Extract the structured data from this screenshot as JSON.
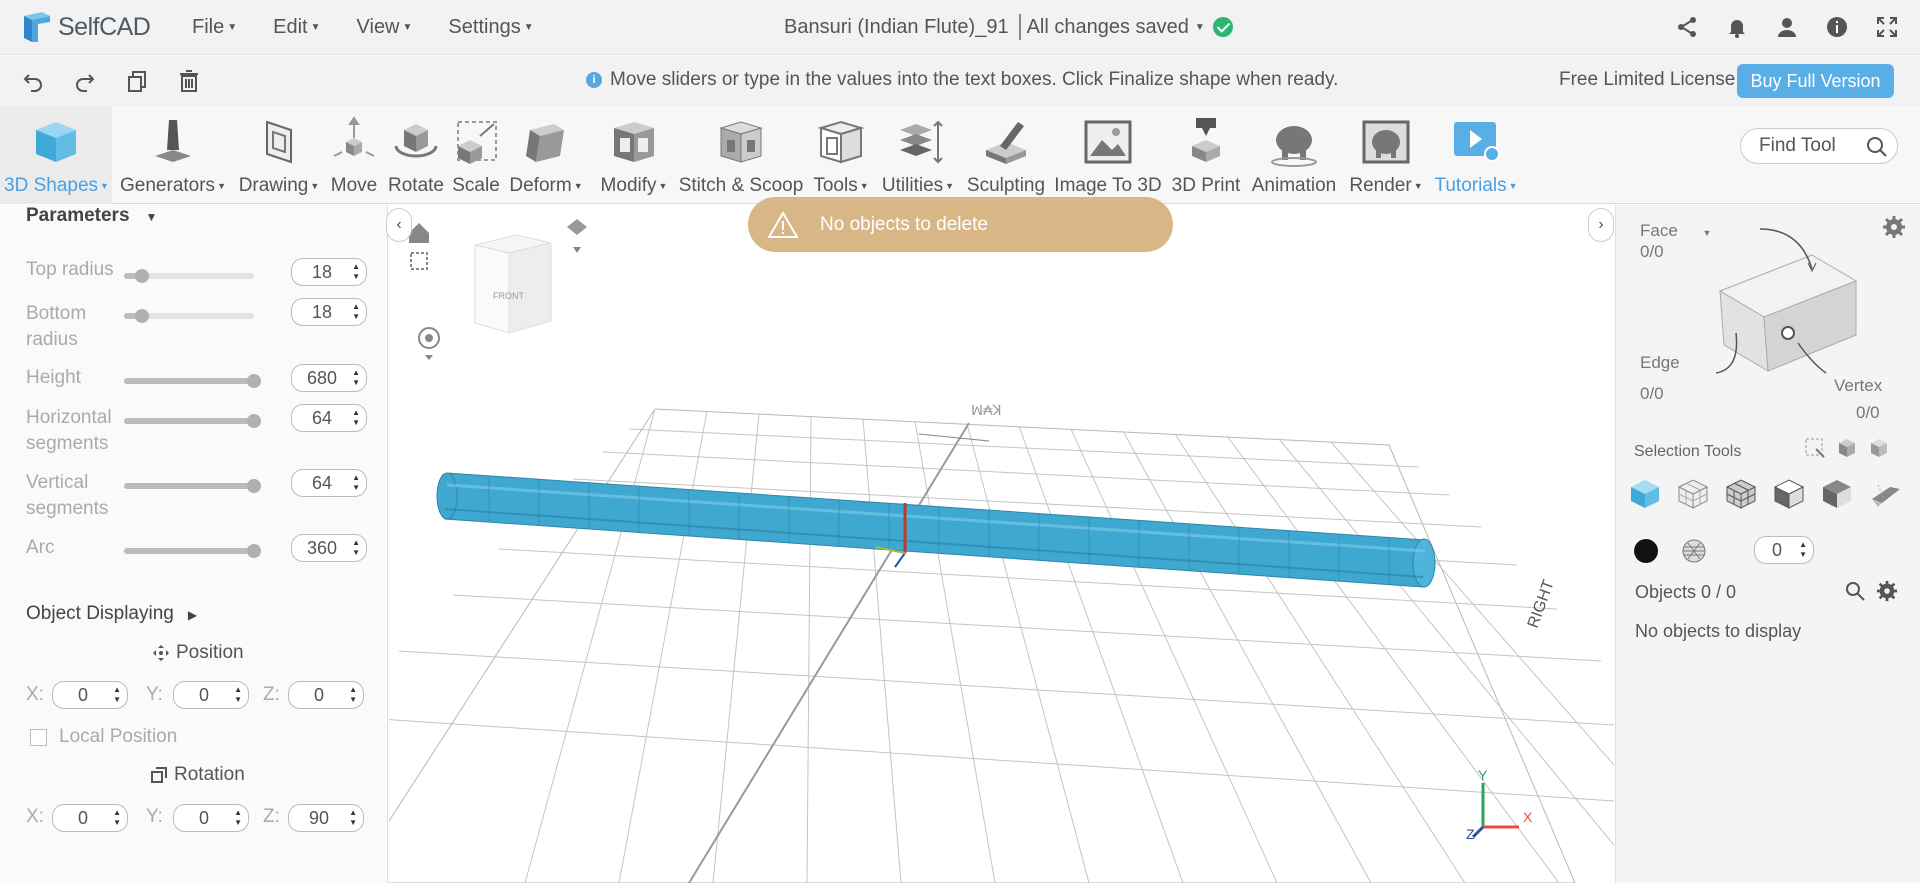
{
  "app": {
    "logo_text": "SelfCAD",
    "menus": [
      {
        "label": "File"
      },
      {
        "label": "Edit"
      },
      {
        "label": "View"
      },
      {
        "label": "Settings"
      }
    ],
    "document_title": "Bansuri (Indian Flute)_91",
    "save_status": "All changes saved"
  },
  "hintbar": {
    "hint": "Move sliders or type in the values into the text boxes. Click Finalize shape when ready.",
    "license": "Free Limited License",
    "buy_label": "Buy Full Version"
  },
  "toolbar": {
    "tools": [
      {
        "label": "3D Shapes",
        "icon": "cube-icon"
      },
      {
        "label": "Generators",
        "icon": "generator-icon"
      },
      {
        "label": "Drawing",
        "icon": "drawing-icon"
      },
      {
        "label": "Move",
        "icon": "move-icon"
      },
      {
        "label": "Rotate",
        "icon": "rotate-icon"
      },
      {
        "label": "Scale",
        "icon": "scale-icon"
      },
      {
        "label": "Deform",
        "icon": "deform-icon"
      },
      {
        "label": "Modify",
        "icon": "modify-icon"
      },
      {
        "label": "Stitch & Scoop",
        "icon": "stitch-scoop-icon"
      },
      {
        "label": "Tools",
        "icon": "tools-icon"
      },
      {
        "label": "Utilities",
        "icon": "utilities-icon"
      },
      {
        "label": "Sculpting",
        "icon": "sculpting-icon"
      },
      {
        "label": "Image To 3D",
        "icon": "image-to-3d-icon"
      },
      {
        "label": "3D Print",
        "icon": "3d-print-icon"
      },
      {
        "label": "Animation",
        "icon": "animation-icon"
      },
      {
        "label": "Render",
        "icon": "render-icon"
      },
      {
        "label": "Tutorials",
        "icon": "tutorials-icon"
      }
    ],
    "find_tool_placeholder": "Find Tool"
  },
  "parameters": {
    "title": "Parameters",
    "rows": [
      {
        "label": "Top radius",
        "value": "18",
        "level": 0.14
      },
      {
        "label": "Bottom radius",
        "value": "18",
        "level": 0.14
      },
      {
        "label": "Height",
        "value": "680",
        "level": 1.0
      },
      {
        "label": "Horizontal segments",
        "value": "64",
        "level": 1.0
      },
      {
        "label": "Vertical segments",
        "value": "64",
        "level": 1.0
      },
      {
        "label": "Arc",
        "value": "360",
        "level": 1.0
      }
    ]
  },
  "object_displaying": {
    "title": "Object Displaying",
    "position_label": "Position",
    "position": {
      "x": "0",
      "y": "0",
      "z": "0"
    },
    "local_position_label": "Local Position",
    "rotation_label": "Rotation",
    "rotation": {
      "x": "0",
      "y": "0",
      "z": "90"
    },
    "axis_x": "X:",
    "axis_y": "Y:",
    "axis_z": "Z:"
  },
  "viewport": {
    "toast": "No objects to delete",
    "view_cube_face": "FRONT",
    "grid_label_right": "RIGHT",
    "axis_y": "Y",
    "axis_x": "X",
    "axis_z": "Z",
    "object_color": "#3fa8d0"
  },
  "right_panel": {
    "face_label": "Face",
    "face_count": "0/0",
    "edge_label": "Edge",
    "edge_count": "0/0",
    "vertex_label": "Vertex",
    "vertex_count": "0/0",
    "selection_tools_label": "Selection Tools",
    "selection_number": "0",
    "objects_label": "Objects 0 / 0",
    "no_objects": "No objects to display"
  }
}
